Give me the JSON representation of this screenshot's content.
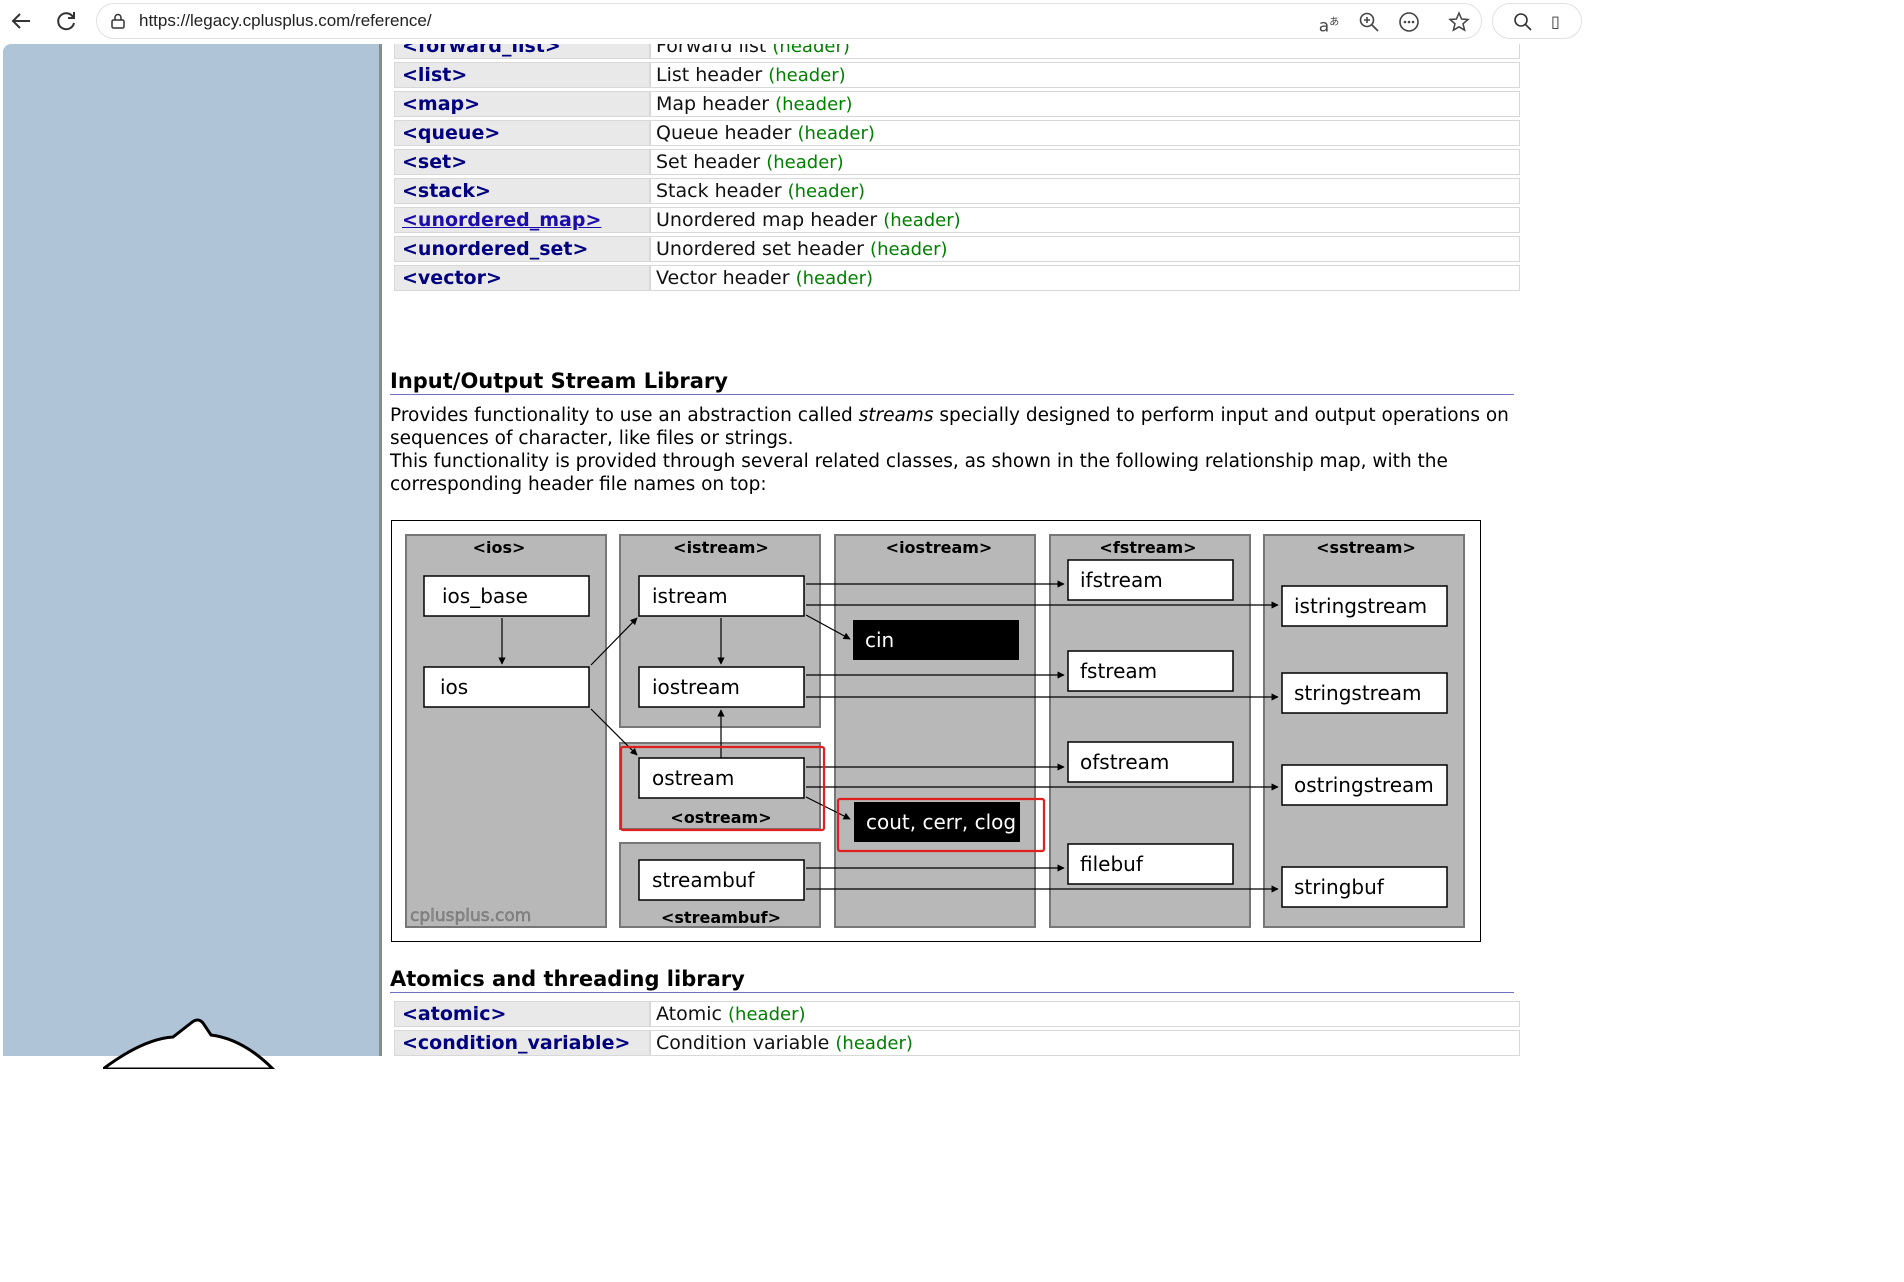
{
  "browser": {
    "url": "https://legacy.cplusplus.com/reference/",
    "icons": [
      "back-icon",
      "refresh-icon",
      "lock-icon",
      "read-aloud-icon",
      "zoom-icon",
      "more-icon",
      "favorite-icon",
      "search-icon"
    ]
  },
  "containers_table": [
    {
      "name": "<forward_list>",
      "desc": "Forward list",
      "tag": "(header)",
      "link": false
    },
    {
      "name": "<list>",
      "desc": "List header",
      "tag": "(header)",
      "link": false
    },
    {
      "name": "<map>",
      "desc": "Map header",
      "tag": "(header)",
      "link": false
    },
    {
      "name": "<queue>",
      "desc": "Queue header",
      "tag": "(header)",
      "link": false
    },
    {
      "name": "<set>",
      "desc": "Set header",
      "tag": "(header)",
      "link": false
    },
    {
      "name": "<stack>",
      "desc": "Stack header",
      "tag": "(header)",
      "link": false
    },
    {
      "name": "<unordered_map>",
      "desc": "Unordered map header",
      "tag": "(header)",
      "link": true
    },
    {
      "name": "<unordered_set>",
      "desc": "Unordered set header",
      "tag": "(header)",
      "link": false
    },
    {
      "name": "<vector>",
      "desc": "Vector header",
      "tag": "(header)",
      "link": false
    }
  ],
  "io_section": {
    "title": "Input/Output Stream Library",
    "para1_pre": "Provides functionality to use an abstraction called ",
    "para1_em": "streams",
    "para1_post": " specially designed to perform input and output operations on sequences of character, like files or strings.",
    "para2": "This functionality is provided through several related classes, as shown in the following relationship map, with the corresponding header file names on top:"
  },
  "diagram": {
    "columns": [
      "<ios>",
      "<istream>",
      "<iostream>",
      "<fstream>",
      "<sstream>"
    ],
    "sub_headers": {
      "ostream": "<ostream>",
      "streambuf": "<streambuf>"
    },
    "classes": {
      "ios_base": "ios_base",
      "ios": "ios",
      "istream": "istream",
      "iostream": "iostream",
      "ostream": "ostream",
      "streambuf": "streambuf",
      "ifstream": "ifstream",
      "fstream": "fstream",
      "ofstream": "ofstream",
      "filebuf": "filebuf",
      "istringstream": "istringstream",
      "stringstream": "stringstream",
      "ostringstream": "ostringstream",
      "stringbuf": "stringbuf"
    },
    "objects": {
      "cin": "cin",
      "cout": "cout, cerr, clog"
    },
    "watermark": "cplusplus.com",
    "highlight_color": "#e02020"
  },
  "atomics_section": {
    "title": "Atomics and threading library",
    "rows": [
      {
        "name": "<atomic>",
        "desc": "Atomic",
        "tag": "(header)"
      },
      {
        "name": "<condition_variable>",
        "desc": "Condition variable",
        "tag": "(header)"
      }
    ]
  }
}
